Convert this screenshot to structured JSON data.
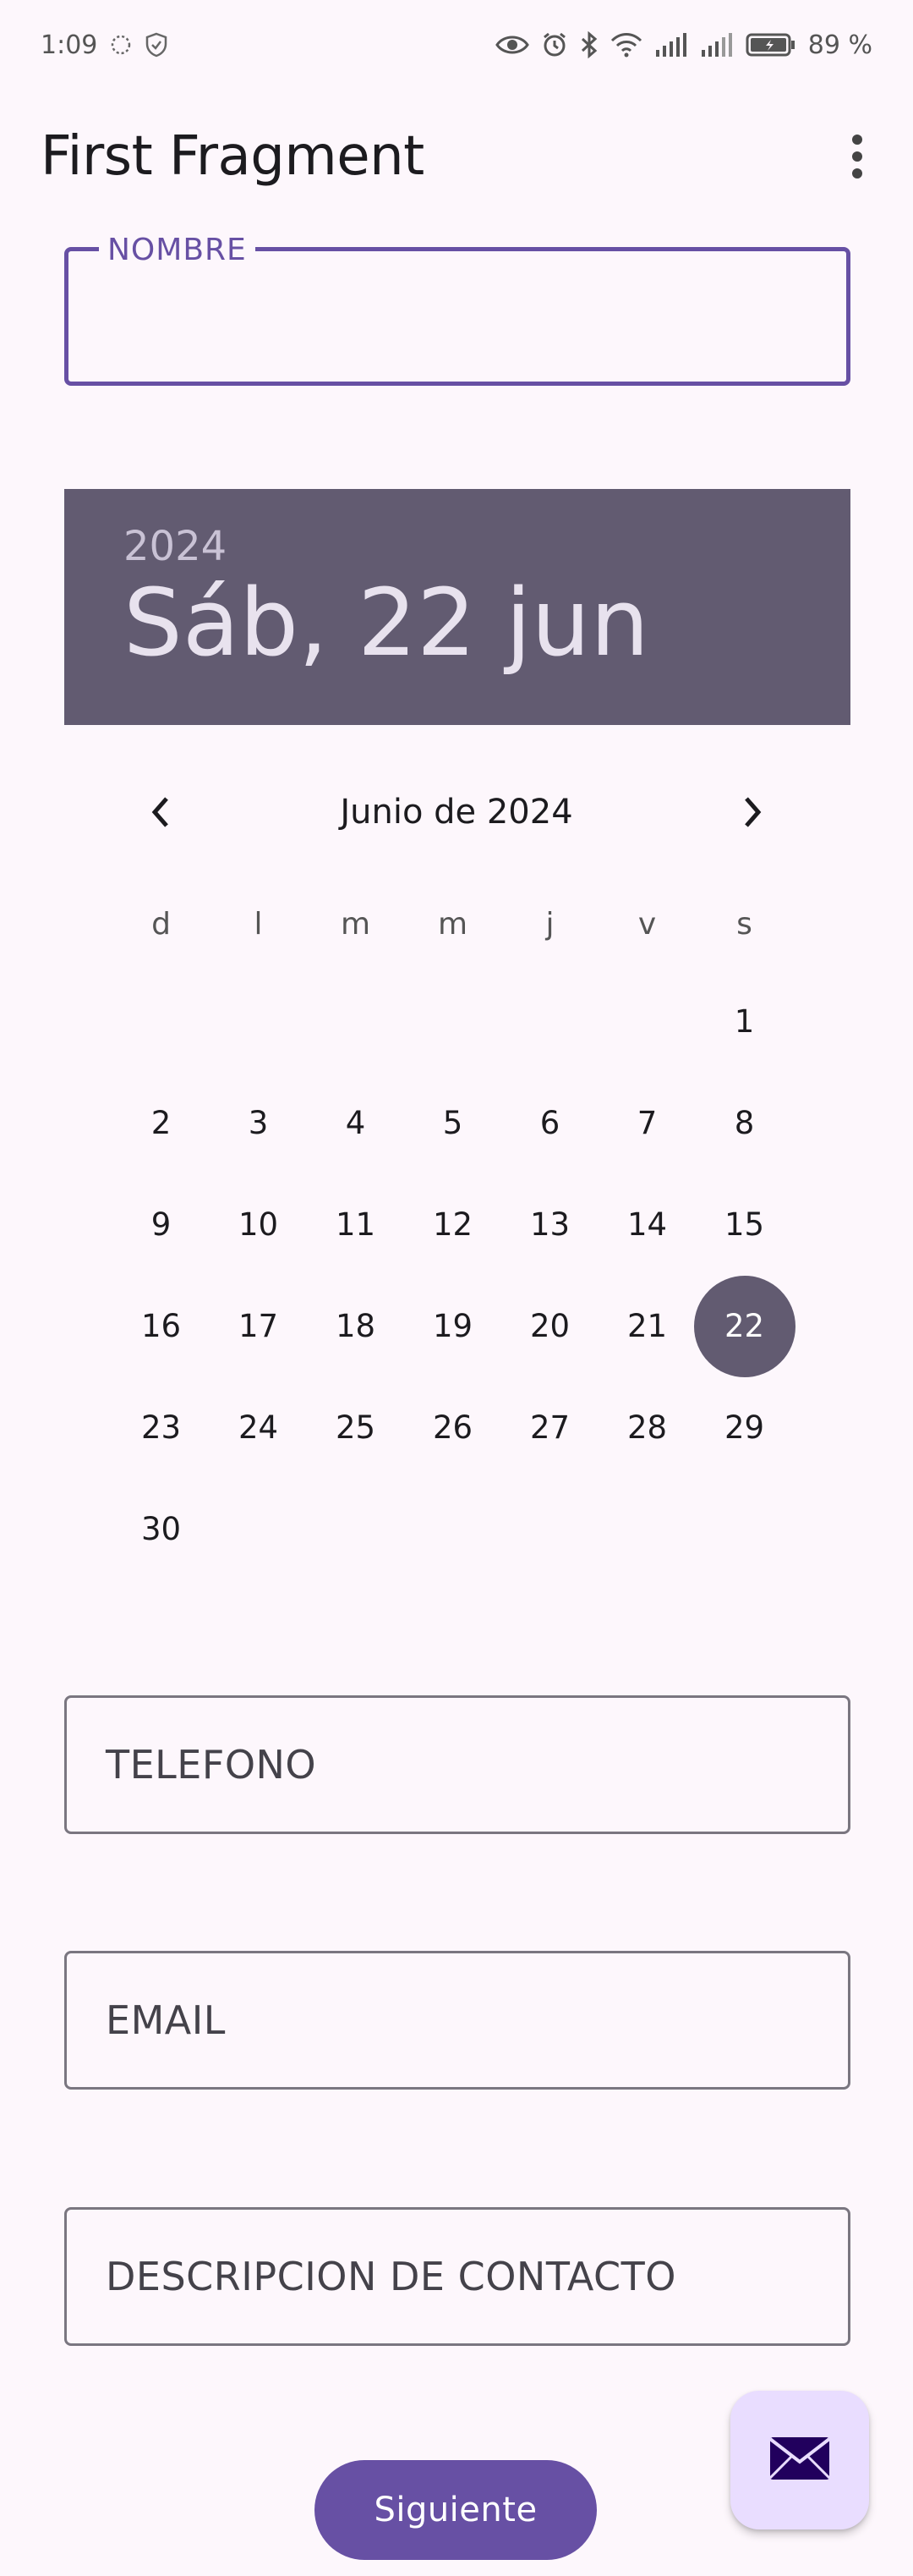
{
  "status_bar": {
    "time": "1:09",
    "battery": "89 %",
    "icons": [
      "loading-icon",
      "shield-icon",
      "eye-icon",
      "alarm-icon",
      "bluetooth-icon",
      "wifi-icon",
      "signal-icon",
      "signal-icon-2",
      "battery-icon"
    ]
  },
  "app_bar": {
    "title": "First Fragment",
    "overflow_icon": "more-vert-icon"
  },
  "nombre_field": {
    "label": "NOMBRE",
    "value": ""
  },
  "date_picker": {
    "year": "2024",
    "selected_date": "Sáb, 22 jun",
    "month_label": "Junio de 2024",
    "weekdays": [
      "d",
      "l",
      "m",
      "m",
      "j",
      "v",
      "s"
    ],
    "first_weekday_index": 6,
    "days_in_month": 30,
    "selected_day": 22,
    "accent_color": "#625b71"
  },
  "telefono_field": {
    "label": "TELEFONO",
    "value": ""
  },
  "email_field": {
    "label": "EMAIL",
    "value": ""
  },
  "descripcion_field": {
    "label": "DESCRIPCION DE CONTACTO",
    "value": ""
  },
  "fab": {
    "icon": "email-icon"
  },
  "next_button": {
    "label": "Siguiente",
    "color": "#6750a4"
  }
}
